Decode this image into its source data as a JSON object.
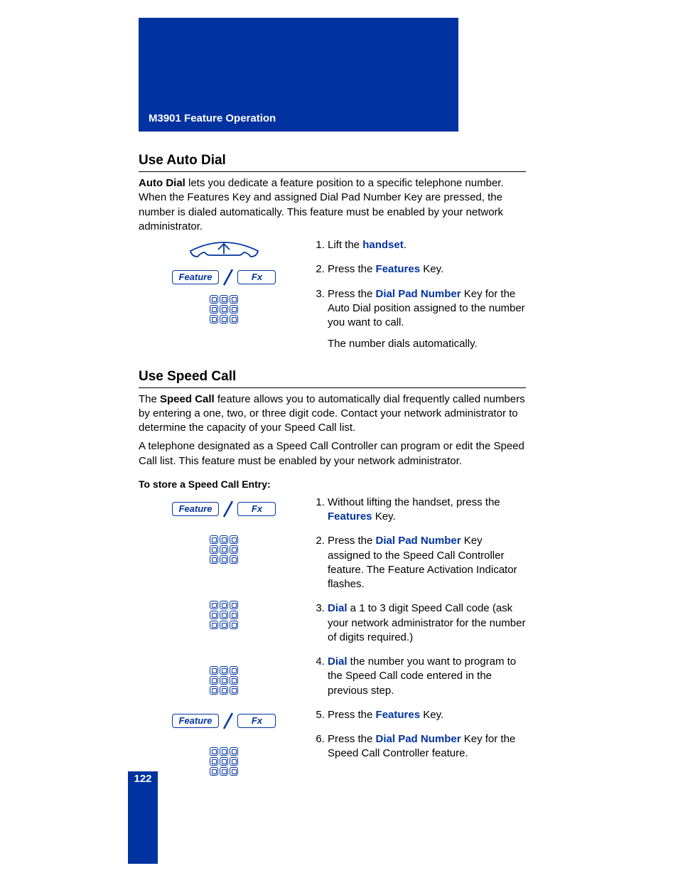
{
  "header": {
    "title": "M3901 Feature Operation"
  },
  "page_number": "122",
  "section1": {
    "title": "Use Auto Dial",
    "intro_lead": "Auto Dial",
    "intro_rest": " lets you dedicate a feature position to a specific telephone number. When the Features Key and assigned Dial Pad Number Key are pressed, the number is dialed automatically. This feature must be enabled by your network administrator.",
    "icons": {
      "feature_label": "Feature",
      "fx_label": "Fx"
    },
    "steps": {
      "s1_pre": "Lift the ",
      "s1_key": "handset",
      "s1_post": ".",
      "s2_pre": "Press the ",
      "s2_key": "Features",
      "s2_post": " Key.",
      "s3_pre": "Press the ",
      "s3_key": "Dial Pad Number",
      "s3_post": " Key for the Auto Dial position assigned to the number you want to call.",
      "s3_followup": "The number dials automatically."
    }
  },
  "section2": {
    "title": "Use Speed Call",
    "intro1_pre": "The ",
    "intro1_key": "Speed Call",
    "intro1_post": " feature allows you to automatically dial frequently called numbers by entering a one, two, or three digit code. Contact your network administrator to determine the capacity of your Speed Call list.",
    "intro2": "A telephone designated as a Speed Call Controller can program or edit the Speed Call list. This feature must be enabled by your network administrator.",
    "subheading": "To store a Speed Call Entry:",
    "icons": {
      "feature_label": "Feature",
      "fx_label": "Fx"
    },
    "steps": {
      "s1_pre": "Without lifting the handset, press the ",
      "s1_key": "Features",
      "s1_post": " Key.",
      "s2_pre": "Press the ",
      "s2_key": "Dial Pad Number",
      "s2_post": " Key assigned to the Speed Call Controller feature. The Feature Activation Indicator flashes.",
      "s3_key": "Dial",
      "s3_post": " a 1 to 3 digit Speed Call code (ask your network administrator for the number of digits required.)",
      "s4_key": "Dial",
      "s4_post": " the number you want to program to the Speed Call code entered in the previous step.",
      "s5_pre": "Press the ",
      "s5_key": "Features",
      "s5_post": " Key.",
      "s6_pre": "Press the ",
      "s6_key": "Dial Pad Number",
      "s6_post": " Key for the Speed Call Controller feature."
    }
  }
}
